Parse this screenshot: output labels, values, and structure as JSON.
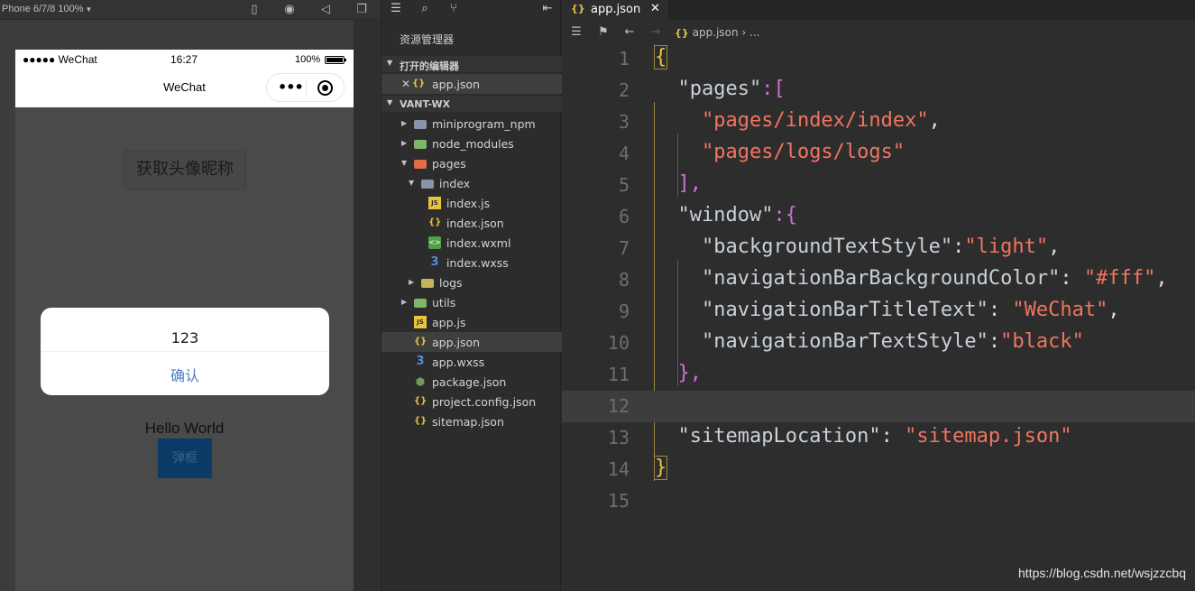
{
  "simulator": {
    "device_label": "Phone 6/7/8 100%",
    "status": {
      "carrier": "●●●●● WeChat",
      "time": "16:27",
      "battery": "100%"
    },
    "nav_title": "WeChat",
    "avatar_button": "获取头像昵称",
    "dialog": {
      "message": "123",
      "confirm": "确认"
    },
    "hello_text": "Hello World",
    "popup_button": "弹框"
  },
  "explorer": {
    "title": "资源管理器",
    "open_editors_header": "打开的编辑器",
    "open_editor_file": "app.json",
    "project_header": "VANT-WX",
    "tree": [
      {
        "label": "miniprogram_npm",
        "icon": "folder-icon"
      },
      {
        "label": "node_modules",
        "icon": "folder-green-icon"
      },
      {
        "label": "pages",
        "icon": "folder-orange-icon"
      },
      {
        "label": "index",
        "icon": "folder-open-icon"
      },
      {
        "label": "index.js",
        "icon": "js-file-icon"
      },
      {
        "label": "index.json",
        "icon": "json-file-icon"
      },
      {
        "label": "index.wxml",
        "icon": "wxml-file-icon"
      },
      {
        "label": "index.wxss",
        "icon": "wxss-file-icon"
      },
      {
        "label": "logs",
        "icon": "folder-yellow-icon"
      },
      {
        "label": "utils",
        "icon": "folder-green-icon"
      },
      {
        "label": "app.js",
        "icon": "js-file-icon"
      },
      {
        "label": "app.json",
        "icon": "json-file-icon"
      },
      {
        "label": "app.wxss",
        "icon": "wxss-file-icon"
      },
      {
        "label": "package.json",
        "icon": "package-icon"
      },
      {
        "label": "project.config.json",
        "icon": "json-file-icon"
      },
      {
        "label": "sitemap.json",
        "icon": "json-file-icon"
      }
    ]
  },
  "editor": {
    "tab_label": "app.json",
    "breadcrumb_file": "app.json",
    "breadcrumb_more": "...",
    "line_numbers": [
      "1",
      "2",
      "3",
      "4",
      "5",
      "6",
      "7",
      "8",
      "9",
      "10",
      "11",
      "12",
      "13",
      "14",
      "15"
    ],
    "code": {
      "l1": "{",
      "l2_key": "\"pages\"",
      "l2_rest": ":[",
      "l3_val": "\"pages/index/index\"",
      "l4_val": "\"pages/logs/logs\"",
      "l5": "],",
      "l6_key": "\"window\"",
      "l6_rest": ":{",
      "l7_key": "\"backgroundTextStyle\"",
      "l7_val": "\"light\"",
      "l8_key": "\"navigationBarBackgroundColor\"",
      "l8_val": "\"#fff\"",
      "l9_key": "\"navigationBarTitleText\"",
      "l9_val": "\"WeChat\"",
      "l10_key": "\"navigationBarTextStyle\"",
      "l10_val": "\"black\"",
      "l11": "},",
      "l13_key": "\"sitemapLocation\"",
      "l13_val": "\"sitemap.json\"",
      "l14": "}"
    }
  },
  "watermark": "https://blog.csdn.net/wsjzzcbq",
  "colors": {
    "string": "#f07560",
    "brace": "#e9c33b",
    "bracket": "#d16fd6",
    "link_blue": "#4a7ec9"
  }
}
